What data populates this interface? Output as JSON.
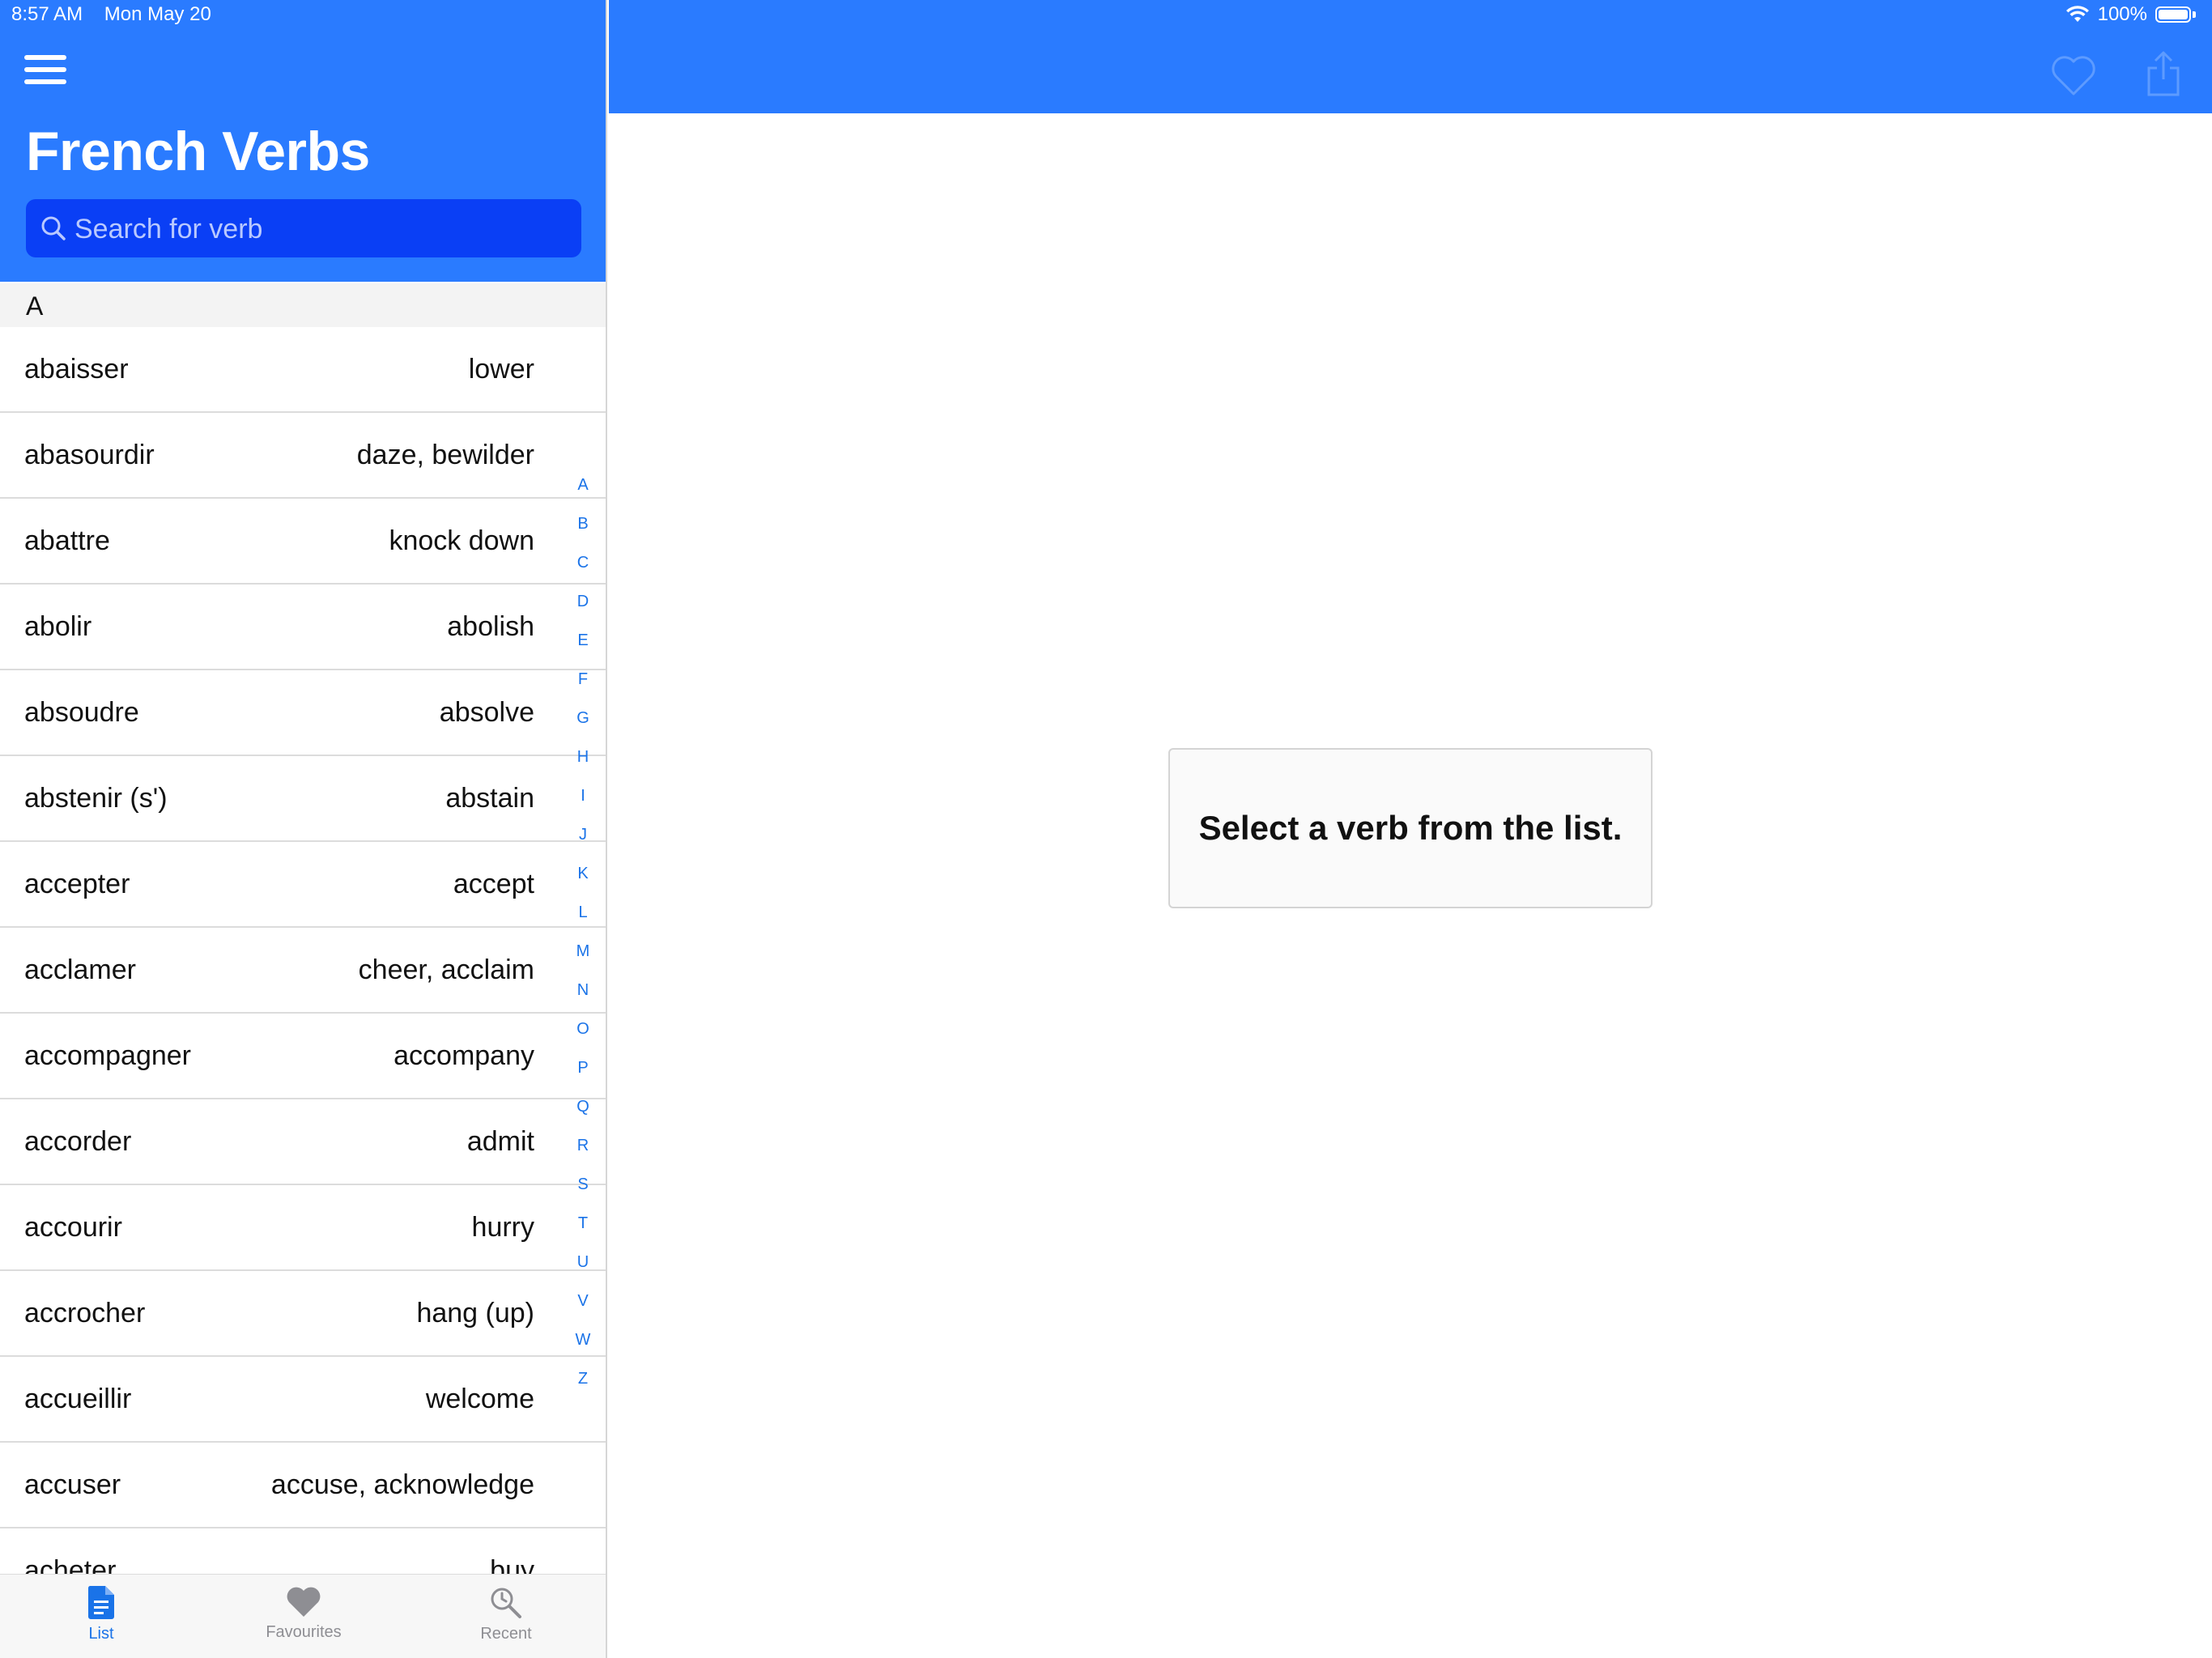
{
  "status_bar": {
    "time": "8:57 AM",
    "date": "Mon May 20",
    "battery": "100%"
  },
  "master": {
    "title": "French Verbs",
    "search_placeholder": "Search for verb",
    "section": "A",
    "verbs": [
      {
        "verb": "abaisser",
        "meaning": "lower"
      },
      {
        "verb": "abasourdir",
        "meaning": "daze, bewilder"
      },
      {
        "verb": "abattre",
        "meaning": "knock down"
      },
      {
        "verb": "abolir",
        "meaning": "abolish"
      },
      {
        "verb": "absoudre",
        "meaning": "absolve"
      },
      {
        "verb": "abstenir (s')",
        "meaning": "abstain"
      },
      {
        "verb": "accepter",
        "meaning": "accept"
      },
      {
        "verb": "acclamer",
        "meaning": "cheer, acclaim"
      },
      {
        "verb": "accompagner",
        "meaning": "accompany"
      },
      {
        "verb": "accorder",
        "meaning": "admit"
      },
      {
        "verb": "accourir",
        "meaning": "hurry"
      },
      {
        "verb": "accrocher",
        "meaning": "hang (up)"
      },
      {
        "verb": "accueillir",
        "meaning": "welcome"
      },
      {
        "verb": "accuser",
        "meaning": "accuse, acknowledge"
      },
      {
        "verb": "acheter",
        "meaning": "buy"
      }
    ],
    "index_letters": [
      "A",
      "B",
      "C",
      "D",
      "E",
      "F",
      "G",
      "H",
      "I",
      "J",
      "K",
      "L",
      "M",
      "N",
      "O",
      "P",
      "Q",
      "R",
      "S",
      "T",
      "U",
      "V",
      "W",
      "Z"
    ],
    "tabs": [
      {
        "label": "List",
        "icon": "document-icon",
        "active": true
      },
      {
        "label": "Favourites",
        "icon": "heart-icon",
        "active": false
      },
      {
        "label": "Recent",
        "icon": "recent-search-icon",
        "active": false
      }
    ]
  },
  "detail": {
    "placeholder": "Select a verb from the list."
  },
  "colors": {
    "header_blue": "#2a7bff",
    "search_blue": "#0a3ff5",
    "accent": "#1a73e8",
    "tab_inactive": "#8e8e93"
  }
}
